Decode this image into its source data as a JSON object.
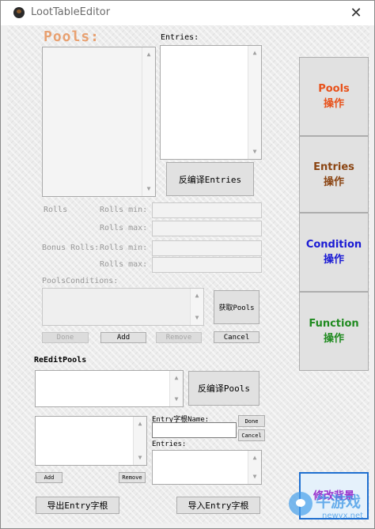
{
  "window": {
    "title": "LootTableEditor",
    "close_glyph": "✕"
  },
  "pools_section": {
    "title": "Pools:",
    "entries_label": "Entries:",
    "decompile_entries_button": "反编译Entries",
    "rolls_label": "Rolls",
    "rolls_min_label": "Rolls min:",
    "rolls_max_label": "Rolls max:",
    "bonus_rolls_label": "Bonus Rolls:",
    "bonus_rolls_min_label": "Rolls min:",
    "bonus_rolls_max_label": "Rolls max:",
    "rolls_min_value": "",
    "rolls_max_value": "",
    "bonus_rolls_min_value": "",
    "bonus_rolls_max_value": "",
    "pools_conditions_label": "PoolsConditions:",
    "get_pools_button": "获取Pools",
    "done_button": "Done",
    "add_button": "Add",
    "remove_button": "Remove",
    "cancel_button": "Cancel"
  },
  "reedit_section": {
    "title": "ReEditPools",
    "decompile_pools_button": "反编译Pools",
    "entry_name_label": "Entry字根Name:",
    "entry_name_value": "",
    "done_button": "Done",
    "cancel_button": "Cancel",
    "entries_label": "Entries:",
    "add_button": "Add",
    "remove_button": "Remove",
    "export_button": "导出Entry字根",
    "import_button": "导入Entry字根"
  },
  "sidebar": {
    "buttons": [
      {
        "title": "Pools",
        "subtitle": "操作",
        "color": "#e8511a"
      },
      {
        "title": "Entries",
        "subtitle": "操作",
        "color": "#8b4513"
      },
      {
        "title": "Condition",
        "subtitle": "操作",
        "color": "#1a1ad4"
      },
      {
        "title": "Function",
        "subtitle": "操作",
        "color": "#1f8a1f"
      }
    ],
    "change_background_button": "修改背景",
    "change_background_color": "#9932cc"
  },
  "watermark": {
    "cn": "牛游戏",
    "url": "newyx.net"
  },
  "colors": {
    "accent": "#1e6fd0",
    "pools_title": "#e8a070"
  }
}
